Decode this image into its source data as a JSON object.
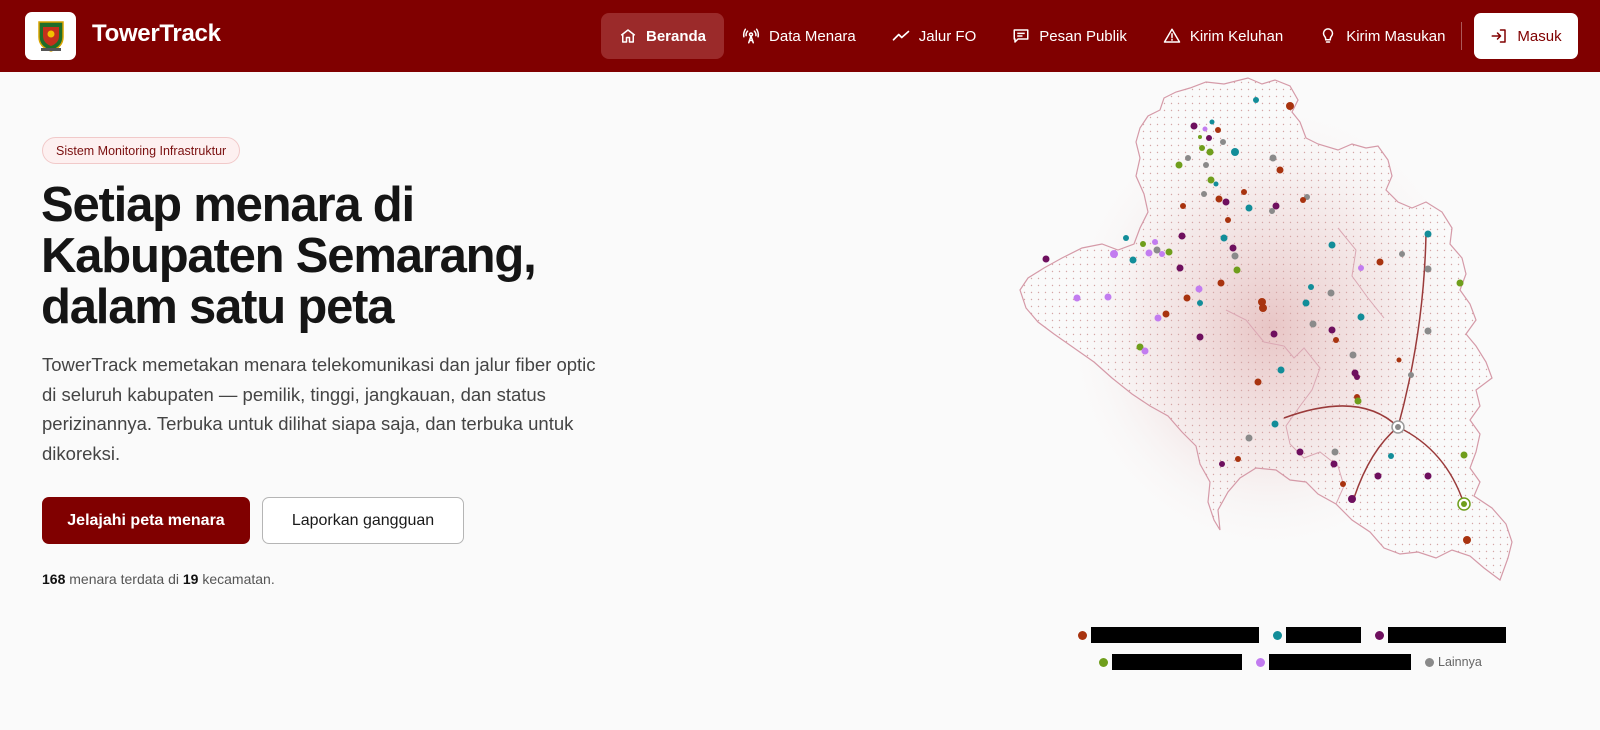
{
  "app": {
    "brand": "TowerTrack",
    "logo_icon": "regency-emblem-icon"
  },
  "nav": {
    "items": [
      {
        "label": "Beranda",
        "icon": "home-icon",
        "active": true
      },
      {
        "label": "Data Menara",
        "icon": "antenna-icon",
        "active": false
      },
      {
        "label": "Jalur FO",
        "icon": "trend-line-icon",
        "active": false
      },
      {
        "label": "Pesan Publik",
        "icon": "message-icon",
        "active": false
      },
      {
        "label": "Kirim Keluhan",
        "icon": "warning-icon",
        "active": false
      },
      {
        "label": "Kirim Masukan",
        "icon": "lightbulb-icon",
        "active": false
      }
    ],
    "login_label": "Masuk"
  },
  "hero": {
    "badge": "Sistem Monitoring Infrastruktur",
    "headline_lines": [
      "Setiap menara di",
      "Kabupaten Semarang,",
      "dalam satu peta"
    ],
    "lead": "TowerTrack memetakan menara telekomunikasi dan jalur fiber optic di seluruh kabupaten — pemilik, tinggi, jangkauan, dan status perizinannya. Terbuka untuk dilihat siapa saja, dan terbuka untuk dikoreksi.",
    "cta_primary": "Jelajahi peta menara",
    "cta_secondary": "Laporkan gangguan",
    "stat": {
      "tower_count": "168",
      "text_mid": "menara terdata di",
      "district_count": "19",
      "text_end": "kecamatan."
    }
  },
  "legend": {
    "items": [
      {
        "color": "#a8330f",
        "label": "",
        "redacted": true
      },
      {
        "color": "#128d99",
        "label": "",
        "redacted": true
      },
      {
        "color": "#6e0f5e",
        "label": "",
        "redacted": true
      },
      {
        "color": "#6f9e1c",
        "label": "",
        "redacted": true
      },
      {
        "color": "#c27cf0",
        "label": "",
        "redacted": true
      },
      {
        "color": "#8a8a8a",
        "label": "Lainnya",
        "redacted": false
      }
    ]
  },
  "colors": {
    "brand": "#800000",
    "nav_active": "#9b2a2a",
    "badge_bg": "#fdf0f0",
    "page_bg": "#fafafa"
  }
}
